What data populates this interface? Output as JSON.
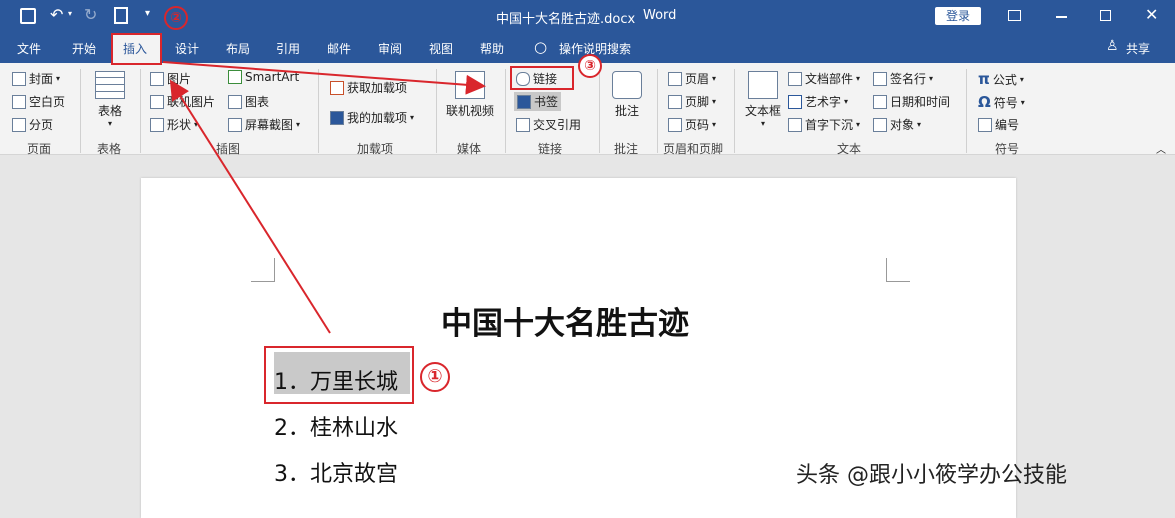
{
  "titlebar": {
    "doc_title": "中国十大名胜古迹.docx",
    "app": "Word",
    "login": "登录"
  },
  "tabs": [
    "文件",
    "开始",
    "插入",
    "设计",
    "布局",
    "引用",
    "邮件",
    "审阅",
    "视图",
    "帮助",
    "操作说明搜索"
  ],
  "share": "共享",
  "ribbon": {
    "pages": {
      "items": [
        "封面",
        "空白页",
        "分页"
      ],
      "group": "页面"
    },
    "tables": {
      "label": "表格",
      "group": "表格"
    },
    "illustrations": {
      "items": [
        "图片",
        "联机图片",
        "形状",
        "SmartArt",
        "图表",
        "屏幕截图"
      ],
      "group": "插图"
    },
    "addins": {
      "items": [
        "获取加载项",
        "我的加载项"
      ],
      "group": "加载项"
    },
    "media": {
      "label": "联机视频",
      "group": "媒体"
    },
    "links": {
      "items": [
        "链接",
        "书签",
        "交叉引用"
      ],
      "group": "链接"
    },
    "comments": {
      "label": "批注",
      "group": "批注"
    },
    "headerfooter": {
      "items": [
        "页眉",
        "页脚",
        "页码"
      ],
      "group": "页眉和页脚"
    },
    "text": {
      "textbox": "文本框",
      "items": [
        "文档部件",
        "艺术字",
        "首字下沉",
        "签名行",
        "日期和时间",
        "对象"
      ],
      "group": "文本"
    },
    "symbols": {
      "items": [
        "公式",
        "符号",
        "编号"
      ],
      "group": "符号"
    }
  },
  "document": {
    "title": "中国十大名胜古迹",
    "list": [
      "1．万里长城",
      "2．桂林山水",
      "3．北京故宫"
    ]
  },
  "annotations": [
    "①",
    "②",
    "③"
  ],
  "watermark": "头条 @跟小小筱学办公技能"
}
